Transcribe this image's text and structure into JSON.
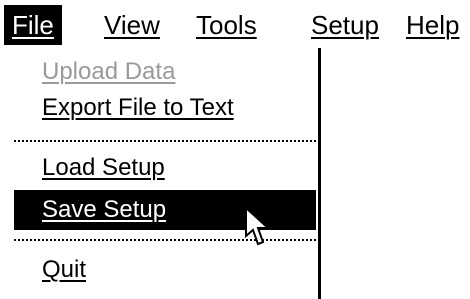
{
  "menubar": {
    "items": [
      {
        "label": "File",
        "active": true
      },
      {
        "label": "View"
      },
      {
        "label": "Tools"
      },
      {
        "label": "Setup"
      },
      {
        "label": "Help"
      }
    ]
  },
  "file_menu": {
    "items": [
      {
        "label": "Upload Data",
        "enabled": false
      },
      {
        "label": "Export File to Text",
        "enabled": true
      },
      {
        "label": "Load Setup",
        "enabled": true
      },
      {
        "label": "Save Setup",
        "enabled": true,
        "highlighted": true
      },
      {
        "label": "Quit",
        "enabled": true
      }
    ]
  },
  "colors": {
    "highlight_bg": "#000000",
    "highlight_fg": "#ffffff",
    "disabled_fg": "#9a9a9a"
  },
  "icons": {
    "cursor": "arrow-cursor-icon"
  }
}
